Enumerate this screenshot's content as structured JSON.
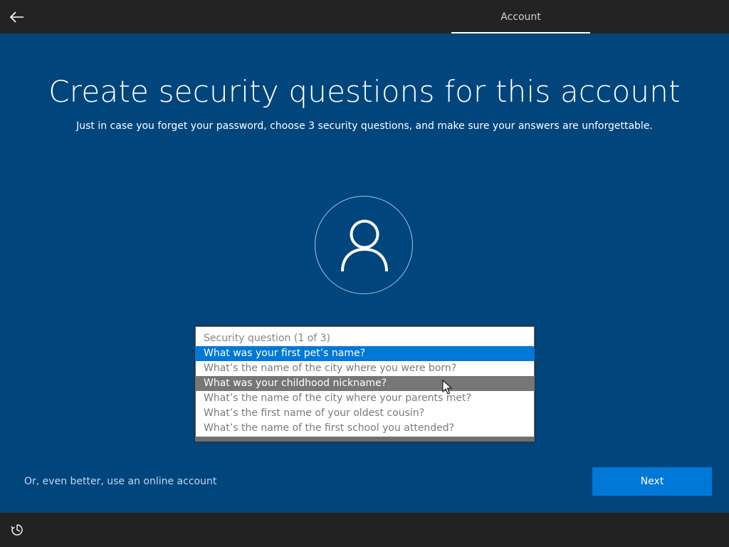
{
  "header": {
    "tab_label": "Account",
    "back_icon": "back-arrow-icon"
  },
  "main": {
    "title": "Create security questions for this account",
    "subtitle": "Just in case you forget your password, choose 3 security questions, and make sure your answers are unforgettable.",
    "avatar_icon": "user-icon"
  },
  "security_dropdown": {
    "header": "Security question (1 of 3)",
    "options": [
      "What was your first pet’s name?",
      "What’s the name of the city where you were born?",
      "What was your childhood nickname?",
      "What’s the name of the city where your parents met?",
      "What’s the first name of your oldest cousin?",
      "What’s the name of the first school you attended?"
    ],
    "selected_index": 0,
    "hovered_index": 2
  },
  "footer": {
    "online_account_link": "Or, even better, use an online account",
    "next_label": "Next",
    "accessibility_icon": "ease-of-access-icon",
    "keyboard_icon": "keyboard-icon"
  },
  "colors": {
    "background": "#00457b",
    "accent": "#0078d7",
    "bar": "#232323",
    "link": "#bdd9f5"
  }
}
